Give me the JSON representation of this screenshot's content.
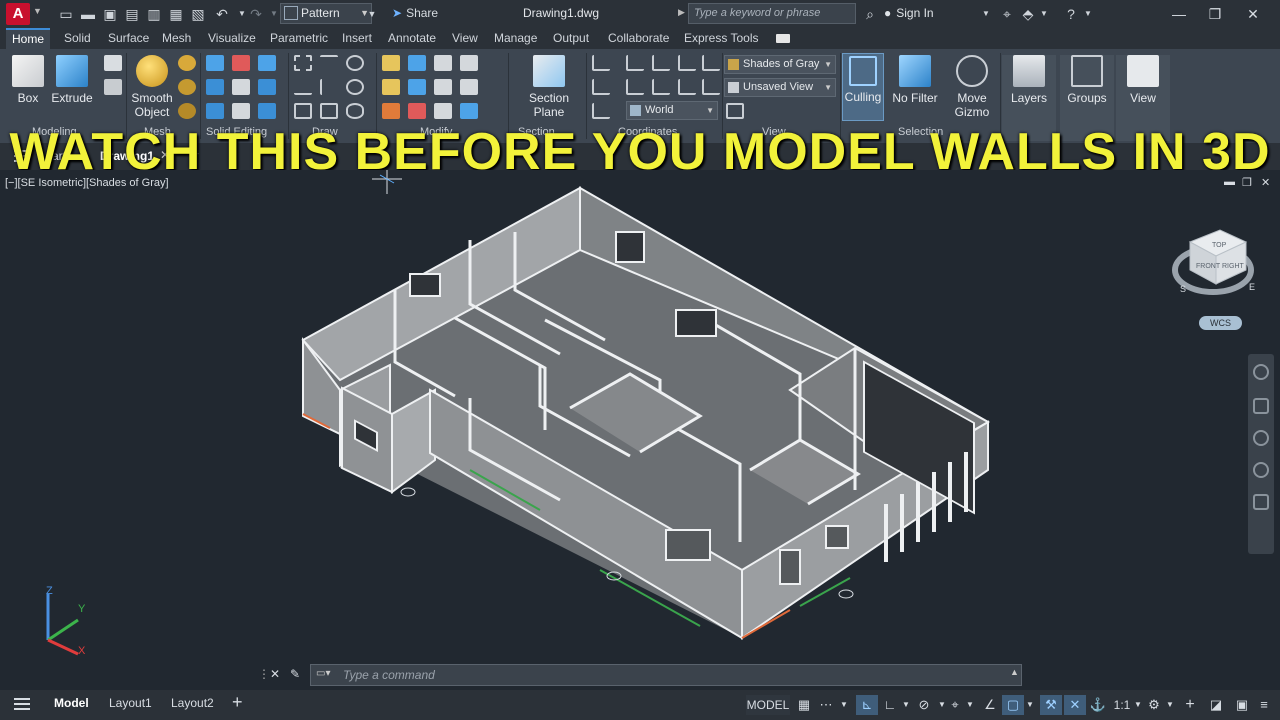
{
  "app": {
    "logo_letter": "A",
    "document_title": "Drawing1.dwg"
  },
  "quick_access": {
    "workspace_value": "Pattern",
    "share_label": "Share"
  },
  "search": {
    "placeholder": "Type a keyword or phrase"
  },
  "account": {
    "sign_in_label": "Sign In"
  },
  "ribbon_tabs": [
    "Home",
    "Solid",
    "Surface",
    "Mesh",
    "Visualize",
    "Parametric",
    "Insert",
    "Annotate",
    "View",
    "Manage",
    "Output",
    "Collaborate",
    "Express Tools"
  ],
  "ribbon": {
    "modeling": {
      "title": "Modeling",
      "box_label": "Box",
      "extrude_label": "Extrude"
    },
    "mesh": {
      "title": "Mesh",
      "smooth_line1": "Smooth",
      "smooth_line2": "Object"
    },
    "solid_editing": {
      "title": "Solid Editing"
    },
    "draw": {
      "title": "Draw"
    },
    "modify": {
      "title": "Modify"
    },
    "section": {
      "title": "Section",
      "line1": "Section",
      "line2": "Plane"
    },
    "coordinates": {
      "title": "Coordinates",
      "ucs_value": "World"
    },
    "view_panel": {
      "title": "View",
      "visual_style_value": "Shades of Gray",
      "named_view_value": "Unsaved View"
    },
    "selection": {
      "title": "Selection",
      "culling_label": "Culling",
      "nofilter_label": "No Filter",
      "gizmo_line1": "Move",
      "gizmo_line2": "Gizmo"
    },
    "layers_label": "Layers",
    "groups_label": "Groups",
    "view_label": "View"
  },
  "banner_text": "WATCH THIS BEFORE YOU MODEL WALLS IN 3D",
  "file_tabs": {
    "start_label": "art",
    "drawing_label": "Drawing1"
  },
  "viewport": {
    "label": "[−][SE Isometric][Shades of Gray]",
    "wcs_label": "WCS",
    "viewcube": {
      "top": "TOP",
      "front": "FRONT",
      "right": "RIGHT",
      "s": "S",
      "e": "E"
    },
    "axis": {
      "x": "X",
      "y": "Y",
      "z": "Z"
    }
  },
  "command": {
    "placeholder": "Type a command"
  },
  "layout_tabs": [
    "Model",
    "Layout1",
    "Layout2"
  ],
  "status": {
    "model_label": "MODEL",
    "scale_label": "1:1"
  },
  "colors": {
    "banner": "#f2f23a",
    "viewport_bg": "#212830",
    "ribbon_bg": "#3d4651",
    "accent": "#3d8cd8"
  }
}
